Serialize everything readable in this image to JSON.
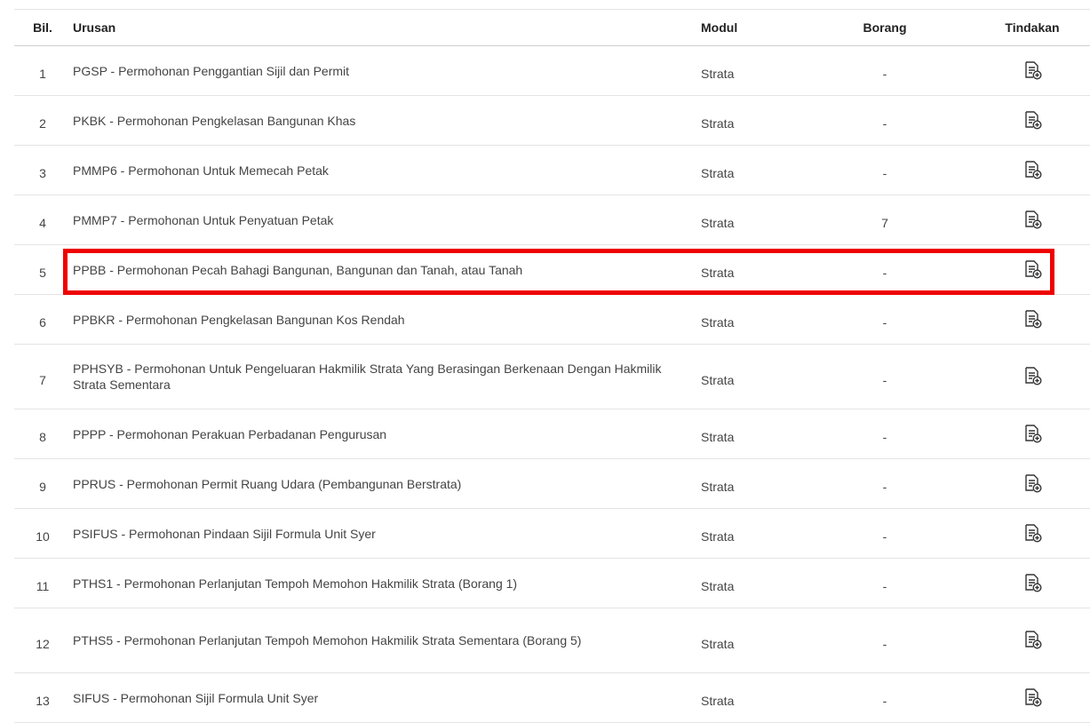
{
  "table": {
    "headers": {
      "bil": "Bil.",
      "urusan": "Urusan",
      "modul": "Modul",
      "borang": "Borang",
      "tindakan": "Tindakan"
    },
    "rows": [
      {
        "bil": "1",
        "urusan": "PGSP - Permohonan Penggantian Sijil dan Permit",
        "modul": "Strata",
        "borang": "-"
      },
      {
        "bil": "2",
        "urusan": "PKBK - Permohonan Pengkelasan Bangunan Khas",
        "modul": "Strata",
        "borang": "-"
      },
      {
        "bil": "3",
        "urusan": "PMMP6 - Permohonan Untuk Memecah Petak",
        "modul": "Strata",
        "borang": "-"
      },
      {
        "bil": "4",
        "urusan": "PMMP7 - Permohonan Untuk Penyatuan Petak",
        "modul": "Strata",
        "borang": "7"
      },
      {
        "bil": "5",
        "urusan": "PPBB - Permohonan Pecah Bahagi Bangunan, Bangunan dan Tanah, atau Tanah",
        "modul": "Strata",
        "borang": "-"
      },
      {
        "bil": "6",
        "urusan": "PPBKR - Permohonan Pengkelasan Bangunan Kos Rendah",
        "modul": "Strata",
        "borang": "-"
      },
      {
        "bil": "7",
        "urusan": "PPHSYB - Permohonan Untuk Pengeluaran Hakmilik Strata Yang Berasingan Berkenaan Dengan Hakmilik Strata Sementara",
        "modul": "Strata",
        "borang": "-"
      },
      {
        "bil": "8",
        "urusan": "PPPP - Permohonan Perakuan Perbadanan Pengurusan",
        "modul": "Strata",
        "borang": "-"
      },
      {
        "bil": "9",
        "urusan": "PPRUS - Permohonan Permit Ruang Udara (Pembangunan Berstrata)",
        "modul": "Strata",
        "borang": "-"
      },
      {
        "bil": "10",
        "urusan": "PSIFUS - Permohonan Pindaan Sijil Formula Unit Syer",
        "modul": "Strata",
        "borang": "-"
      },
      {
        "bil": "11",
        "urusan": "PTHS1 - Permohonan Perlanjutan Tempoh Memohon Hakmilik Strata (Borang 1)",
        "modul": "Strata",
        "borang": "-"
      },
      {
        "bil": "12",
        "urusan": "PTHS5 - Permohonan Perlanjutan Tempoh Memohon Hakmilik Strata Sementara (Borang 5)",
        "modul": "Strata",
        "borang": "-"
      },
      {
        "bil": "13",
        "urusan": "SIFUS - Permohonan Sijil Formula Unit Syer",
        "modul": "Strata",
        "borang": "-"
      }
    ],
    "action_icon": "document-add-icon"
  },
  "colors": {
    "highlight": "#ee0000",
    "icon": "#333333"
  }
}
